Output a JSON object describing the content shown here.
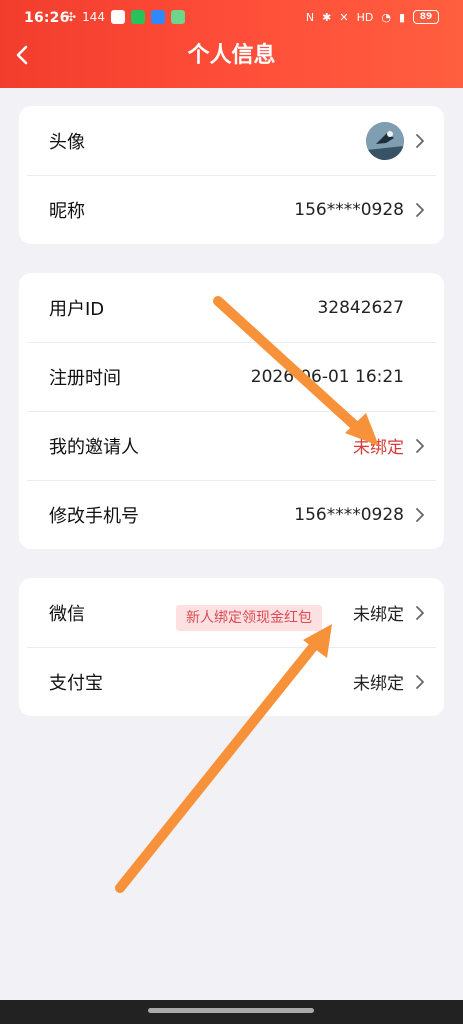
{
  "status_bar": {
    "time": "16:26",
    "network_speed": "144",
    "battery": "89"
  },
  "header": {
    "title": "个人信息"
  },
  "card1": {
    "avatar_label": "头像",
    "nickname_label": "昵称",
    "nickname_value": "156****0928"
  },
  "card2": {
    "user_id_label": "用户ID",
    "user_id_value": "32842627",
    "register_time_label": "注册时间",
    "register_time_value": "2026-06-01 16:21",
    "inviter_label": "我的邀请人",
    "inviter_value": "未绑定",
    "phone_label": "修改手机号",
    "phone_value": "156****0928"
  },
  "card3": {
    "wechat_label": "微信",
    "wechat_promo": "新人绑定领现金红包",
    "wechat_value": "未绑定",
    "alipay_label": "支付宝",
    "alipay_value": "未绑定"
  },
  "colors": {
    "header_red": "#f23d2d",
    "accent_red": "#d93b3b",
    "arrow_orange": "#f7923a"
  }
}
